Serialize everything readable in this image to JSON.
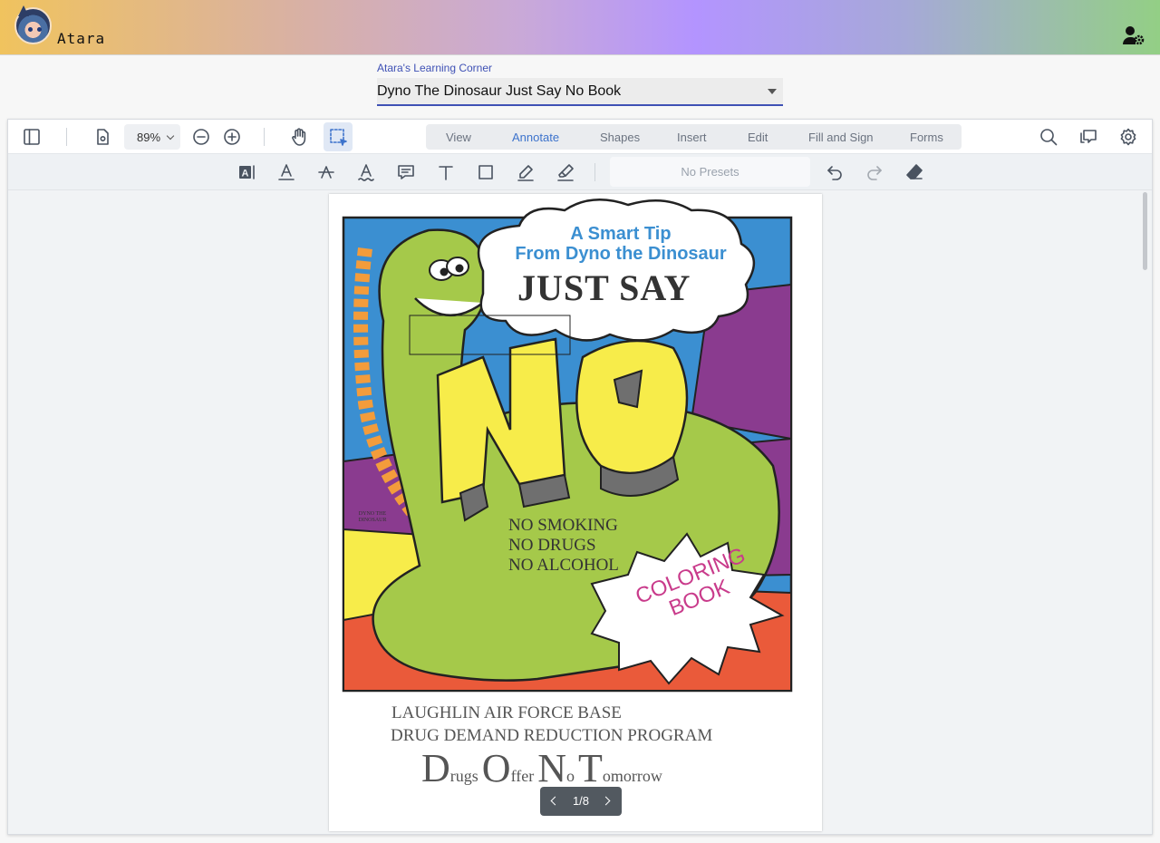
{
  "app": {
    "name": "Atara"
  },
  "document_selector": {
    "label": "Atara's Learning Corner",
    "value": "Dyno The Dinosaur Just Say No Book"
  },
  "toolbar": {
    "zoom": "89%",
    "tabs": [
      "View",
      "Annotate",
      "Shapes",
      "Insert",
      "Edit",
      "Fill and Sign",
      "Forms"
    ],
    "active_tab": "Annotate",
    "presets_label": "No Presets"
  },
  "page_content": {
    "cloud_line1": "A Smart Tip",
    "cloud_line2": "From Dyno the Dinosaur",
    "headline": "JUST SAY",
    "big_word": "NO",
    "list": [
      "NO SMOKING",
      "NO DRUGS",
      "NO ALCOHOL"
    ],
    "burst_line1": "COLORING",
    "burst_line2": "BOOK",
    "side_mark": "DYNO THE DINOSAUR",
    "footer_line1": "LAUGHLIN AIR FORCE BASE",
    "footer_line2": "DRUG DEMAND REDUCTION PROGRAM",
    "acronym": [
      {
        "cap": "D",
        "rest": "rugs"
      },
      {
        "cap": "O",
        "rest": "ffer"
      },
      {
        "cap": "N",
        "rest": "o"
      },
      {
        "cap": "T",
        "rest": "omorrow"
      }
    ]
  },
  "pagination": {
    "label": "1/8",
    "current": 1,
    "total": 8
  },
  "colors": {
    "accent": "#3f51b5",
    "active_tab": "#3d73cc",
    "dino_green": "#a5c94a",
    "sky_blue": "#3b8fd1",
    "yellow": "#f7ec4a",
    "purple": "#8a3b8f",
    "red_orange": "#ea5a3a",
    "burst_pink": "#c93b8b"
  },
  "icons": [
    "avatar",
    "user-gear-icon",
    "sidebar-toggle-icon",
    "page-settings-icon",
    "zoom-out-icon",
    "zoom-in-icon",
    "pan-hand-icon",
    "select-region-icon",
    "search-icon",
    "comments-icon",
    "settings-icon",
    "text-highlight-icon",
    "underline-icon",
    "strikeout-icon",
    "squiggly-icon",
    "comment-icon",
    "freetext-icon",
    "rectangle-icon",
    "freehand-icon",
    "highlighter-pen-icon",
    "undo-icon",
    "redo-icon",
    "eraser-icon"
  ]
}
